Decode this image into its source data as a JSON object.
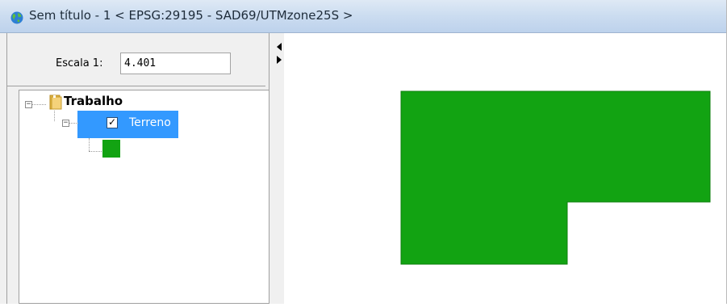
{
  "window": {
    "title": "Sem título - 1 < EPSG:29195 - SAD69/UTMzone25S >"
  },
  "scale": {
    "label": "Escala 1:",
    "value": "4.401"
  },
  "tree": {
    "root_label": "Trabalho",
    "layer_label": "Terreno",
    "layer_checked": true,
    "layer_color": "#12a312"
  },
  "map": {
    "polygon_fill": "#12a312",
    "polygon_stroke": "#0f7f0f"
  }
}
